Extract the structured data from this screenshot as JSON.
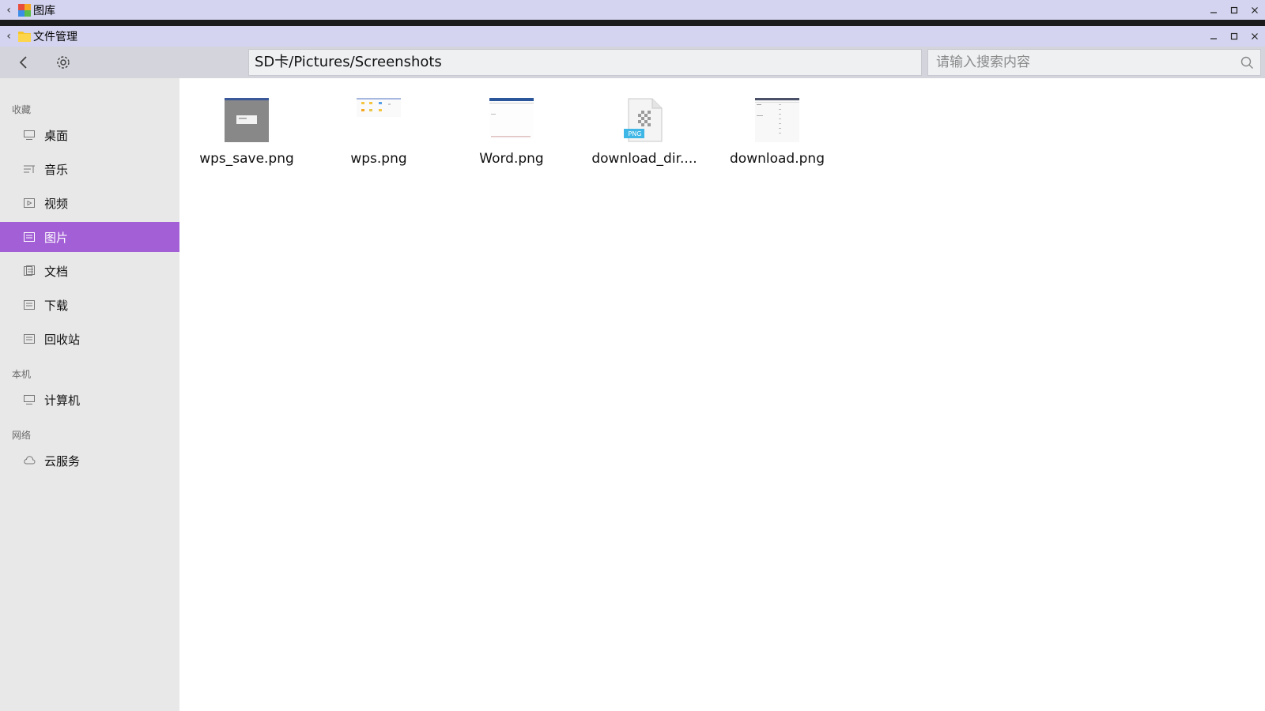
{
  "outer_window": {
    "title": "图库",
    "back_glyph": "‹",
    "controls": {
      "minimize": "minimize-icon",
      "maximize": "maximize-icon",
      "close": "close-icon"
    }
  },
  "window": {
    "title": "文件管理",
    "back_glyph": "‹"
  },
  "toolbar": {
    "path": "SD卡/Pictures/Screenshots",
    "search_placeholder": "请输入搜索内容"
  },
  "sidebar": {
    "sections": [
      {
        "label": "收藏",
        "items": [
          {
            "label": "桌面",
            "icon": "desktop-icon"
          },
          {
            "label": "音乐",
            "icon": "music-icon"
          },
          {
            "label": "视频",
            "icon": "video-icon"
          },
          {
            "label": "图片",
            "icon": "picture-icon",
            "active": true
          },
          {
            "label": "文档",
            "icon": "document-icon"
          },
          {
            "label": "下载",
            "icon": "download-icon"
          },
          {
            "label": "回收站",
            "icon": "trash-icon"
          }
        ]
      },
      {
        "label": "本机",
        "items": [
          {
            "label": "计算机",
            "icon": "computer-icon"
          }
        ]
      },
      {
        "label": "网络",
        "items": [
          {
            "label": "云服务",
            "icon": "cloud-icon"
          }
        ]
      }
    ]
  },
  "files": [
    {
      "name": "wps_save.png",
      "thumb": "screenshot-thumbnail"
    },
    {
      "name": "wps.png",
      "thumb": "screenshot-thumbnail"
    },
    {
      "name": "Word.png",
      "thumb": "screenshot-thumbnail"
    },
    {
      "name": "download_dir....",
      "thumb": "png-file-icon",
      "badge": "PNG"
    },
    {
      "name": "download.png",
      "thumb": "screenshot-thumbnail"
    }
  ],
  "colors": {
    "titlebar": "#d4d4f0",
    "toolbar": "#d4d4dc",
    "sidebar": "#e8e8e8",
    "active_item": "#a35fd6",
    "png_badge": "#3fb7e6"
  }
}
